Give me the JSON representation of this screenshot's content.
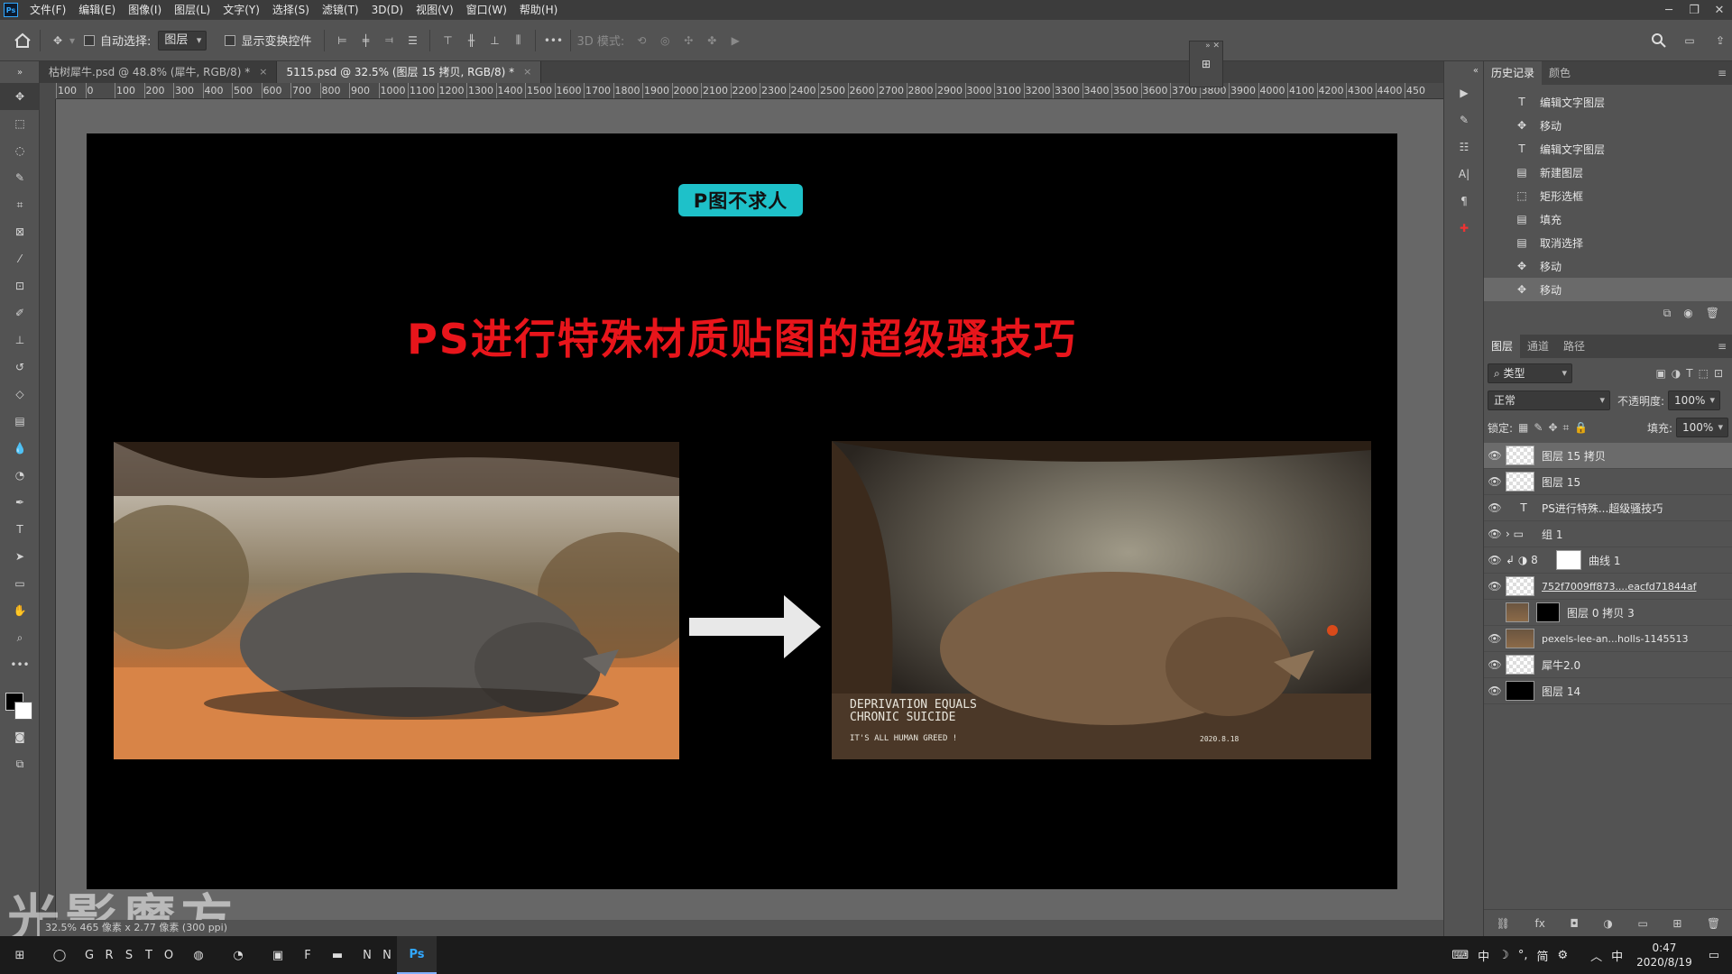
{
  "app": {
    "logo": "Ps"
  },
  "menu": [
    "文件(F)",
    "编辑(E)",
    "图像(I)",
    "图层(L)",
    "文字(Y)",
    "选择(S)",
    "滤镜(T)",
    "3D(D)",
    "视图(V)",
    "窗口(W)",
    "帮助(H)"
  ],
  "options": {
    "auto_select_label": "自动选择:",
    "auto_select_value": "图层",
    "show_transform_label": "显示变换控件",
    "mode_3d_label": "3D 模式:"
  },
  "tabs": [
    {
      "label": "枯树犀牛.psd @ 48.8% (犀牛, RGB/8) *",
      "close": "×"
    },
    {
      "label": "5115.psd @ 32.5% (图层 15 拷贝, RGB/8) *",
      "close": "×"
    }
  ],
  "ruler_h": [
    "100",
    "0",
    "100",
    "200",
    "300",
    "400",
    "500",
    "600",
    "700",
    "800",
    "900",
    "1000",
    "1100",
    "1200",
    "1300",
    "1400",
    "1500",
    "1600",
    "1700",
    "1800",
    "1900",
    "2000",
    "2100",
    "2200",
    "2300",
    "2400",
    "2500",
    "2600",
    "2700",
    "2800",
    "2900",
    "3000",
    "3100",
    "3200",
    "3300",
    "3400",
    "3500",
    "3600",
    "3700",
    "3800",
    "3900",
    "4000",
    "4100",
    "4200",
    "4300",
    "4400",
    "450"
  ],
  "canvas": {
    "badge": "P图不求人",
    "headline": "PS进行特殊材质贴图的超级骚技巧",
    "poster_line1": "DEPRIVATION EQUALS",
    "poster_line2": "CHRONIC SUICIDE",
    "poster_line3": "IT'S ALL HUMAN GREED !",
    "poster_small": "2020.8.18"
  },
  "history": {
    "tabs": [
      "历史记录",
      "颜色"
    ],
    "items": [
      {
        "icon": "text-icon",
        "label": "编辑文字图层"
      },
      {
        "icon": "move-icon",
        "label": "移动"
      },
      {
        "icon": "text-icon",
        "label": "编辑文字图层"
      },
      {
        "icon": "layer-icon",
        "label": "新建图层"
      },
      {
        "icon": "marquee-icon",
        "label": "矩形选框"
      },
      {
        "icon": "layer-icon",
        "label": "填充"
      },
      {
        "icon": "layer-icon",
        "label": "取消选择"
      },
      {
        "icon": "move-icon",
        "label": "移动"
      },
      {
        "icon": "move-icon",
        "label": "移动"
      }
    ]
  },
  "layers": {
    "tabs": [
      "图层",
      "通道",
      "路径"
    ],
    "filter_label": "类型",
    "blend_mode": "正常",
    "opacity_label": "不透明度:",
    "opacity_value": "100%",
    "lock_label": "锁定:",
    "fill_label": "填充:",
    "fill_value": "100%",
    "items": [
      {
        "name": "图层 15 拷贝",
        "thumb": "transparent",
        "visible": true,
        "selected": true
      },
      {
        "name": "图层 15",
        "thumb": "transparent",
        "visible": true
      },
      {
        "name": "PS进行特殊...超级骚技巧",
        "thumb": "text",
        "visible": true
      },
      {
        "name": "组 1",
        "thumb": "folder",
        "visible": true
      },
      {
        "name": "曲线 1",
        "thumb": "adjustment",
        "visible": true
      },
      {
        "name": "752f7009ff873....eacfd71844af",
        "thumb": "transparent",
        "visible": true
      },
      {
        "name": "图层 0 拷贝 3",
        "thumb": "photo",
        "visible": false
      },
      {
        "name": "pexels-lee-an...holls-1145513",
        "thumb": "photo",
        "visible": true
      },
      {
        "name": "犀牛2.0",
        "thumb": "smart",
        "visible": true
      },
      {
        "name": "图层 14",
        "thumb": "black",
        "visible": true
      }
    ]
  },
  "status": {
    "text": "32.5%  465 像素 x 2.77 像素 (300 ppi)"
  },
  "watermark": "光影魔方",
  "taskbar": {
    "apps": [
      "G",
      "R",
      "S",
      "T",
      "O",
      "F",
      "N",
      "N",
      "Ps"
    ],
    "tray_ime": "中",
    "tray_simp": "简",
    "tray_ime2": "中",
    "time": "0:47",
    "date": "2020/8/19"
  },
  "colors": {
    "accent_badge": "#1ec1c9",
    "headline": "#e8151b"
  }
}
